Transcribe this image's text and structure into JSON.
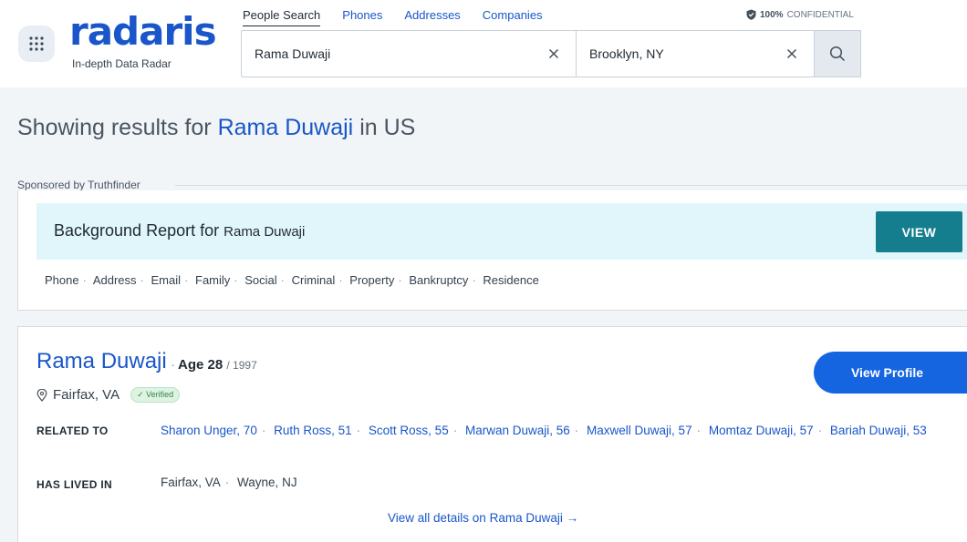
{
  "header": {
    "logo_text": "radaris",
    "tagline": "In-depth Data Radar",
    "nav": [
      "People Search",
      "Phones",
      "Addresses",
      "Companies"
    ],
    "confidential_pct": "100%",
    "confidential_text": "CONFIDENTIAL",
    "search_name": "Rama Duwaji",
    "search_location": "Brooklyn, NY"
  },
  "results": {
    "prefix": "Showing results for",
    "name": "Rama Duwaji",
    "suffix": "in US"
  },
  "sponsored": {
    "label": "Sponsored by Truthfinder",
    "title": "Background Report",
    "title_for": "for",
    "name": "Rama Duwaji",
    "button": "VIEW",
    "categories": [
      "Phone",
      "Address",
      "Email",
      "Family",
      "Social",
      "Criminal",
      "Property",
      "Bankruptcy",
      "Residence"
    ]
  },
  "person": {
    "name": "Rama Duwaji",
    "age_label": "Age 28",
    "birth_year": "/ 1997",
    "location": "Fairfax, VA",
    "verified": "✓ Verified",
    "view_profile": "View Profile",
    "related_label": "RELATED TO",
    "related": [
      "Sharon Unger, 70",
      "Ruth Ross, 51",
      "Scott Ross, 55",
      "Marwan Duwaji, 56",
      "Maxwell Duwaji, 57",
      "Momtaz Duwaji, 57",
      "Bariah Duwaji, 53"
    ],
    "lived_label": "HAS LIVED IN",
    "lived": [
      "Fairfax, VA",
      "Wayne, NJ"
    ],
    "all_details": "View all details on Rama Duwaji →"
  },
  "colors": {
    "brand_blue": "#1a56c9",
    "teal_button": "#147e8f",
    "profile_button": "#1565e0",
    "banner_bg": "#e1f6fb"
  },
  "icons": {
    "menu": "grid-dots-icon",
    "clear": "close-icon",
    "search": "search-icon",
    "shield": "shield-icon",
    "pin": "location-pin-icon"
  }
}
